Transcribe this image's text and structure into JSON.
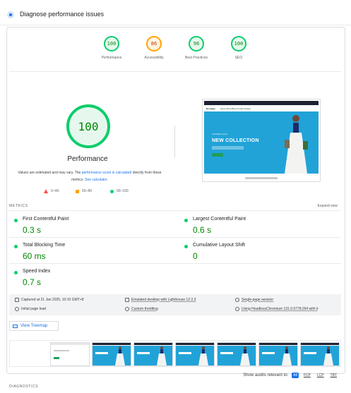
{
  "section": {
    "title": "Diagnose performance issues"
  },
  "gauges": [
    {
      "score": "100",
      "label": "Performance",
      "status": "green"
    },
    {
      "score": "86",
      "label": "Accessibility",
      "status": "orange"
    },
    {
      "score": "96",
      "label": "Best Practices",
      "status": "green"
    },
    {
      "score": "100",
      "label": "SEO",
      "status": "green"
    }
  ],
  "main_score": {
    "score": "100",
    "title": "Performance",
    "note_prefix": "Values are estimated and may vary. The ",
    "note_link1": "performance score is calculated",
    "note_middle": " directly from these metrics. ",
    "note_link2": "See calculator."
  },
  "legend": {
    "fail": "0–49",
    "average": "50–89",
    "pass": "90–100"
  },
  "preview": {
    "brand": "Bondage",
    "menu": "Home   Shop   Blog   Contact   Pages",
    "tagline": "SUMMER SALE",
    "headline": "NEW COLLECTION"
  },
  "metrics": {
    "heading": "METRICS",
    "expand_label": "Expand view",
    "items": [
      {
        "name": "First Contentful Paint",
        "value": "0.3 s"
      },
      {
        "name": "Largest Contentful Paint",
        "value": "0.6 s"
      },
      {
        "name": "Total Blocking Time",
        "value": "60 ms"
      },
      {
        "name": "Cumulative Layout Shift",
        "value": "0"
      },
      {
        "name": "Speed Index",
        "value": "0.7 s"
      }
    ]
  },
  "run_info": {
    "captured": "Captured at 21 Jan 2025, 10:10 GMT+8",
    "emulated": "Emulated desktop with Lighthouse 12.2.3",
    "session": "Single-page session",
    "load": "Initial page load",
    "throttling": "Custom throttling",
    "browser": "Using HeadlessChromium 131.0.6778.264 with lr"
  },
  "treemap": {
    "label": "View Treemap"
  },
  "filmstrip": {
    "frames": 8
  },
  "audits_filter": {
    "label": "Show audits relevant to:",
    "options": [
      "All",
      "FCP",
      "LCP",
      "TBT"
    ]
  },
  "diagnostics": {
    "heading": "DIAGNOSTICS"
  },
  "colors": {
    "pass": "#0cce6b",
    "average": "#ffa400",
    "fail": "#ff4e42",
    "link": "#1a73e8",
    "hero": "#21a3d8"
  }
}
